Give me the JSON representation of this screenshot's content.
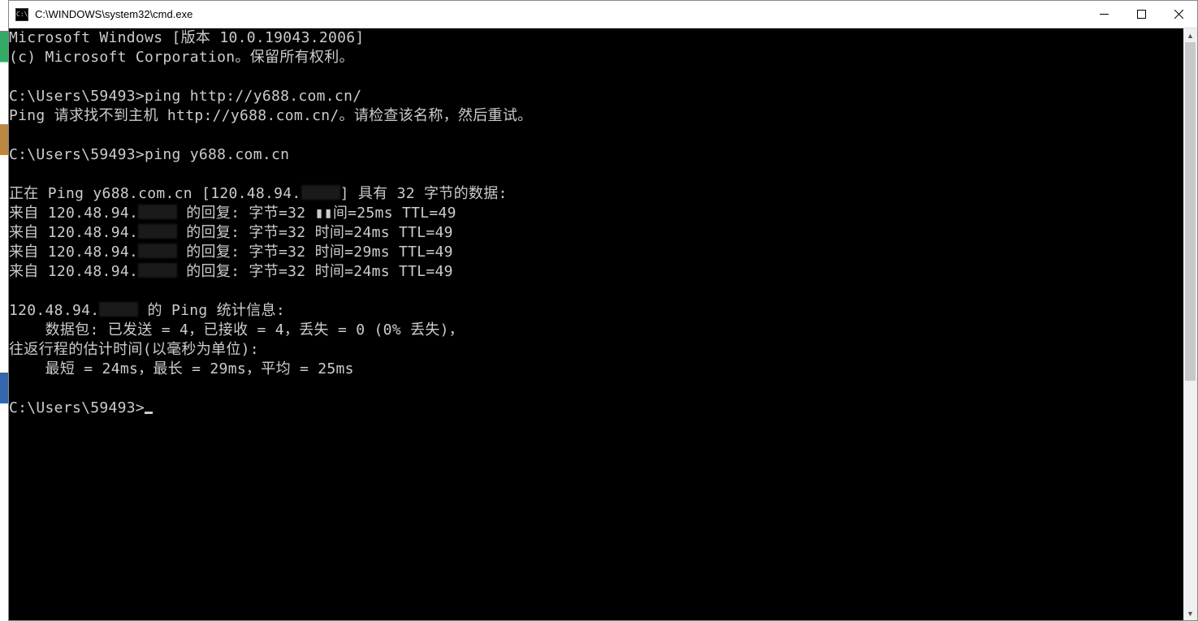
{
  "window": {
    "icon_text": "C:\\",
    "title": "C:\\WINDOWS\\system32\\cmd.exe"
  },
  "terminal": {
    "lines": [
      "Microsoft Windows [版本 10.0.19043.2006]",
      "(c) Microsoft Corporation。保留所有权利。",
      "",
      "C:\\Users\\59493>ping http://y688.com.cn/",
      "Ping 请求找不到主机 http://y688.com.cn/。请检查该名称，然后重试。",
      "",
      "C:\\Users\\59493>ping y688.com.cn",
      "",
      "正在 Ping y688.com.cn [120.48.94.▮▮▮] 具有 32 字节的数据:",
      "来自 120.48.94.▮▮▮ 的回复: 字节=32 ▮▮间=25ms TTL=49",
      "来自 120.48.94.▮▮▮ 的回复: 字节=32 时间=24ms TTL=49",
      "来自 120.48.94.▮▮▮ 的回复: 字节=32 时间=29ms TTL=49",
      "来自 120.48.94.▮▮▮ 的回复: 字节=32 时间=24ms TTL=49",
      "",
      "120.48.94.▮▮▮ 的 Ping 统计信息:",
      "    数据包: 已发送 = 4，已接收 = 4，丢失 = 0 (0% 丢失)，",
      "往返行程的估计时间(以毫秒为单位):",
      "    最短 = 24ms，最长 = 29ms，平均 = 25ms",
      "",
      "C:\\Users\\59493>_"
    ]
  }
}
